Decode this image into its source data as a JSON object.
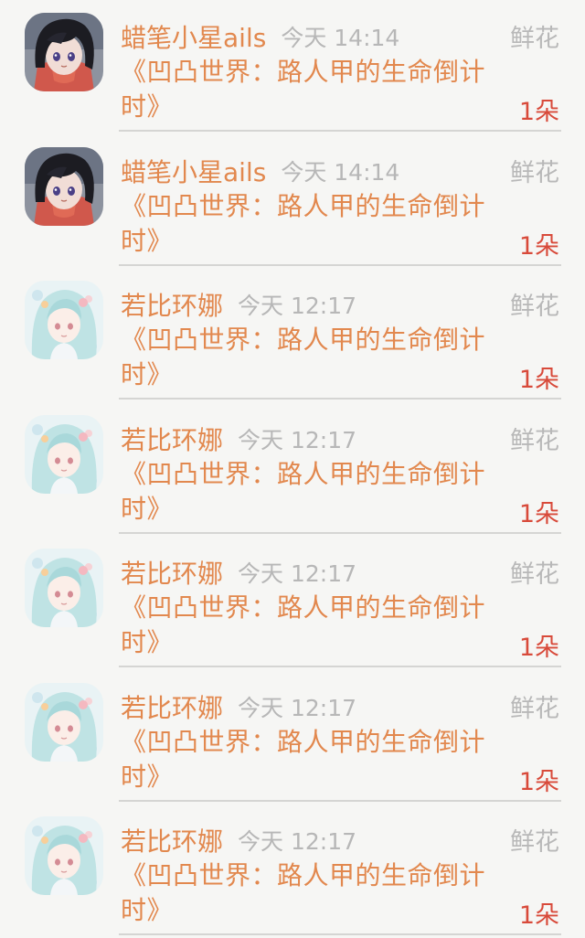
{
  "items": [
    {
      "user": "蜡笔小星ails",
      "time": "今天 14:14",
      "book": "《凹凸世界：路人甲的生命倒计时》",
      "gift": "鲜花",
      "count": "1朵",
      "avatar": "dark"
    },
    {
      "user": "蜡笔小星ails",
      "time": "今天 14:14",
      "book": "《凹凸世界：路人甲的生命倒计时》",
      "gift": "鲜花",
      "count": "1朵",
      "avatar": "dark"
    },
    {
      "user": "若比环娜",
      "time": "今天 12:17",
      "book": "《凹凸世界：路人甲的生命倒计时》",
      "gift": "鲜花",
      "count": "1朵",
      "avatar": "light"
    },
    {
      "user": "若比环娜",
      "time": "今天 12:17",
      "book": "《凹凸世界：路人甲的生命倒计时》",
      "gift": "鲜花",
      "count": "1朵",
      "avatar": "light"
    },
    {
      "user": "若比环娜",
      "time": "今天 12:17",
      "book": "《凹凸世界：路人甲的生命倒计时》",
      "gift": "鲜花",
      "count": "1朵",
      "avatar": "light"
    },
    {
      "user": "若比环娜",
      "time": "今天 12:17",
      "book": "《凹凸世界：路人甲的生命倒计时》",
      "gift": "鲜花",
      "count": "1朵",
      "avatar": "light"
    },
    {
      "user": "若比环娜",
      "time": "今天 12:17",
      "book": "《凹凸世界：路人甲的生命倒计时》",
      "gift": "鲜花",
      "count": "1朵",
      "avatar": "light"
    }
  ],
  "colors": {
    "accent": "#e2884e",
    "count": "#d84a3a",
    "muted": "#b8b8b8",
    "background": "#f6f6f4"
  }
}
